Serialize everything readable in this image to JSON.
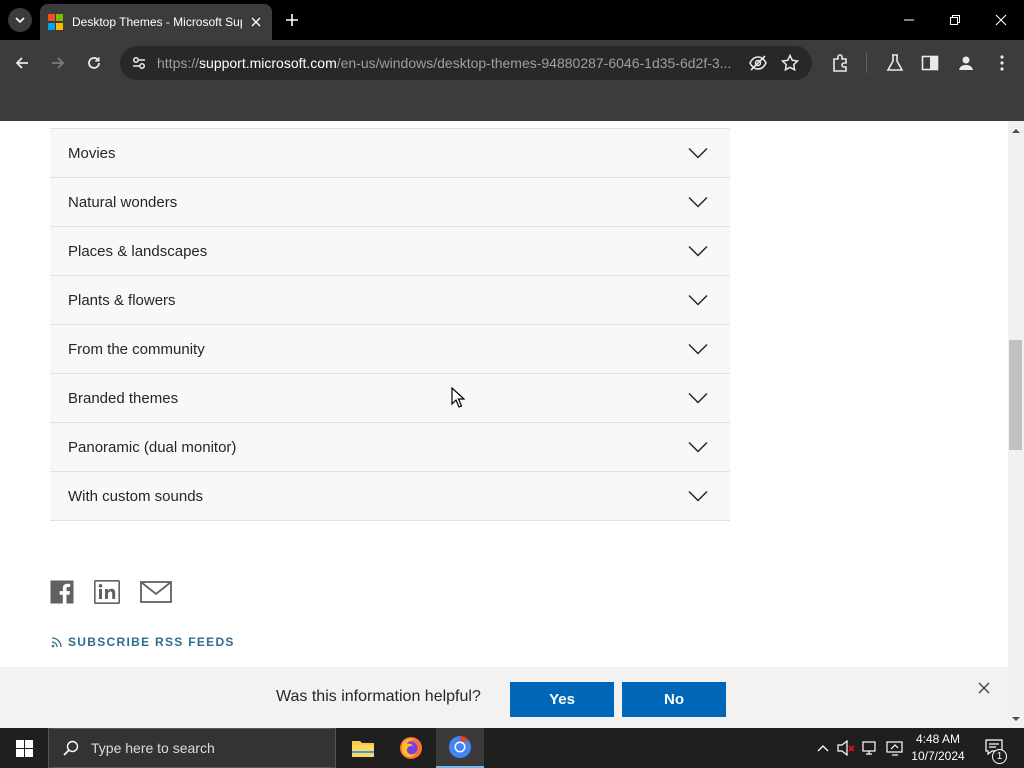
{
  "browser": {
    "tab_title": "Desktop Themes - Microsoft Support",
    "url_scheme": "https://",
    "url_host": "support.microsoft.com",
    "url_path": "/en-us/windows/desktop-themes-94880287-6046-1d35-6d2f-3..."
  },
  "accordion": {
    "items": [
      {
        "label": "Movies"
      },
      {
        "label": "Natural wonders"
      },
      {
        "label": "Places & landscapes"
      },
      {
        "label": "Plants & flowers"
      },
      {
        "label": "From the community"
      },
      {
        "label": "Branded themes"
      },
      {
        "label": "Panoramic (dual monitor)"
      },
      {
        "label": "With custom sounds"
      }
    ]
  },
  "share": {
    "icons": [
      "facebook-icon",
      "linkedin-icon",
      "email-icon"
    ]
  },
  "rss": {
    "label": "SUBSCRIBE RSS FEEDS"
  },
  "feedback": {
    "question": "Was this information helpful?",
    "yes_label": "Yes",
    "no_label": "No"
  },
  "taskbar": {
    "search_placeholder": "Type here to search",
    "time": "4:48 AM",
    "date": "10/7/2024",
    "notification_count": "1"
  },
  "colors": {
    "accent": "#0067b8",
    "rss_link": "#2f6d8f",
    "accordion_bg": "#f8f8f8",
    "feedback_bg": "#f2f2f2"
  }
}
